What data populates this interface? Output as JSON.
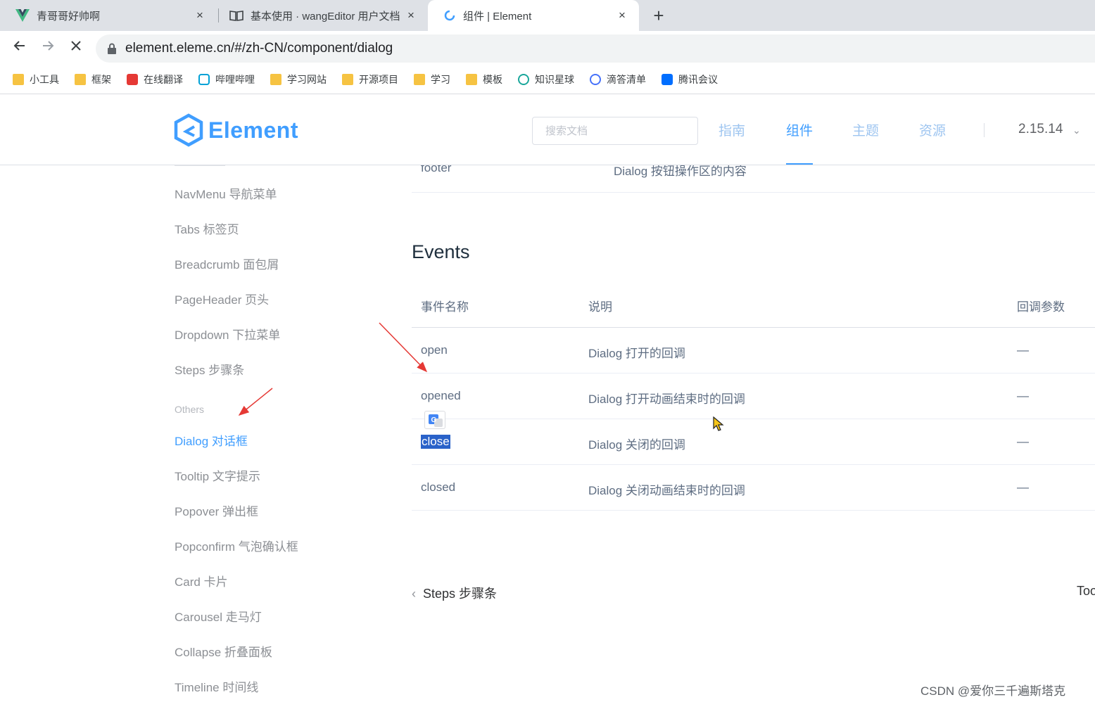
{
  "browser": {
    "tabs": [
      {
        "title": "青哥哥好帅啊",
        "icon": "vue-logo-icon",
        "active": false
      },
      {
        "title": "基本使用 · wangEditor 用户文档",
        "icon": "book-icon",
        "active": false
      },
      {
        "title": "组件 | Element",
        "icon": "element-icon",
        "active": true
      }
    ],
    "close_glyph": "×",
    "new_tab_glyph": "+",
    "url": "element.eleme.cn/#/zh-CN/component/dialog",
    "bookmarks": [
      "小工具",
      "框架",
      "在线翻译",
      "哔哩哔哩",
      "学习网站",
      "开源项目",
      "学习",
      "模板",
      "知识星球",
      "滴答清单",
      "腾讯会议"
    ]
  },
  "site": {
    "logo_text": "Element",
    "search_placeholder": "搜索文档",
    "nav": {
      "guide": "指南",
      "component": "组件",
      "theme": "主题",
      "resource": "资源"
    },
    "version": "2.15.14",
    "accent_color": "#409eff"
  },
  "sidebar": {
    "items": [
      "NavMenu 导航菜单",
      "Tabs 标签页",
      "Breadcrumb 面包屑",
      "PageHeader 页头",
      "Dropdown 下拉菜单",
      "Steps 步骤条"
    ],
    "group_label": "Others",
    "items2": [
      "Dialog 对话框",
      "Tooltip 文字提示",
      "Popover 弹出框",
      "Popconfirm 气泡确认框",
      "Card 卡片",
      "Carousel 走马灯",
      "Collapse 折叠面板",
      "Timeline 时间线"
    ]
  },
  "content": {
    "prev_row": {
      "name": "footer",
      "desc": "Dialog 按钮操作区的内容"
    },
    "events_title": "Events",
    "headers": {
      "name": "事件名称",
      "desc": "说明",
      "param": "回调参数"
    },
    "rows": [
      {
        "name": "open",
        "desc": "Dialog 打开的回调",
        "param": "—"
      },
      {
        "name": "opened",
        "desc": "Dialog 打开动画结束时的回调",
        "param": "—"
      },
      {
        "name": "close",
        "desc": "Dialog 关闭的回调",
        "param": "—"
      },
      {
        "name": "closed",
        "desc": "Dialog 关闭动画结束时的回调",
        "param": "—"
      }
    ],
    "prev_page": "Steps 步骤条",
    "next_page": "Too"
  },
  "watermark": "CSDN @爱你三千遍斯塔克"
}
